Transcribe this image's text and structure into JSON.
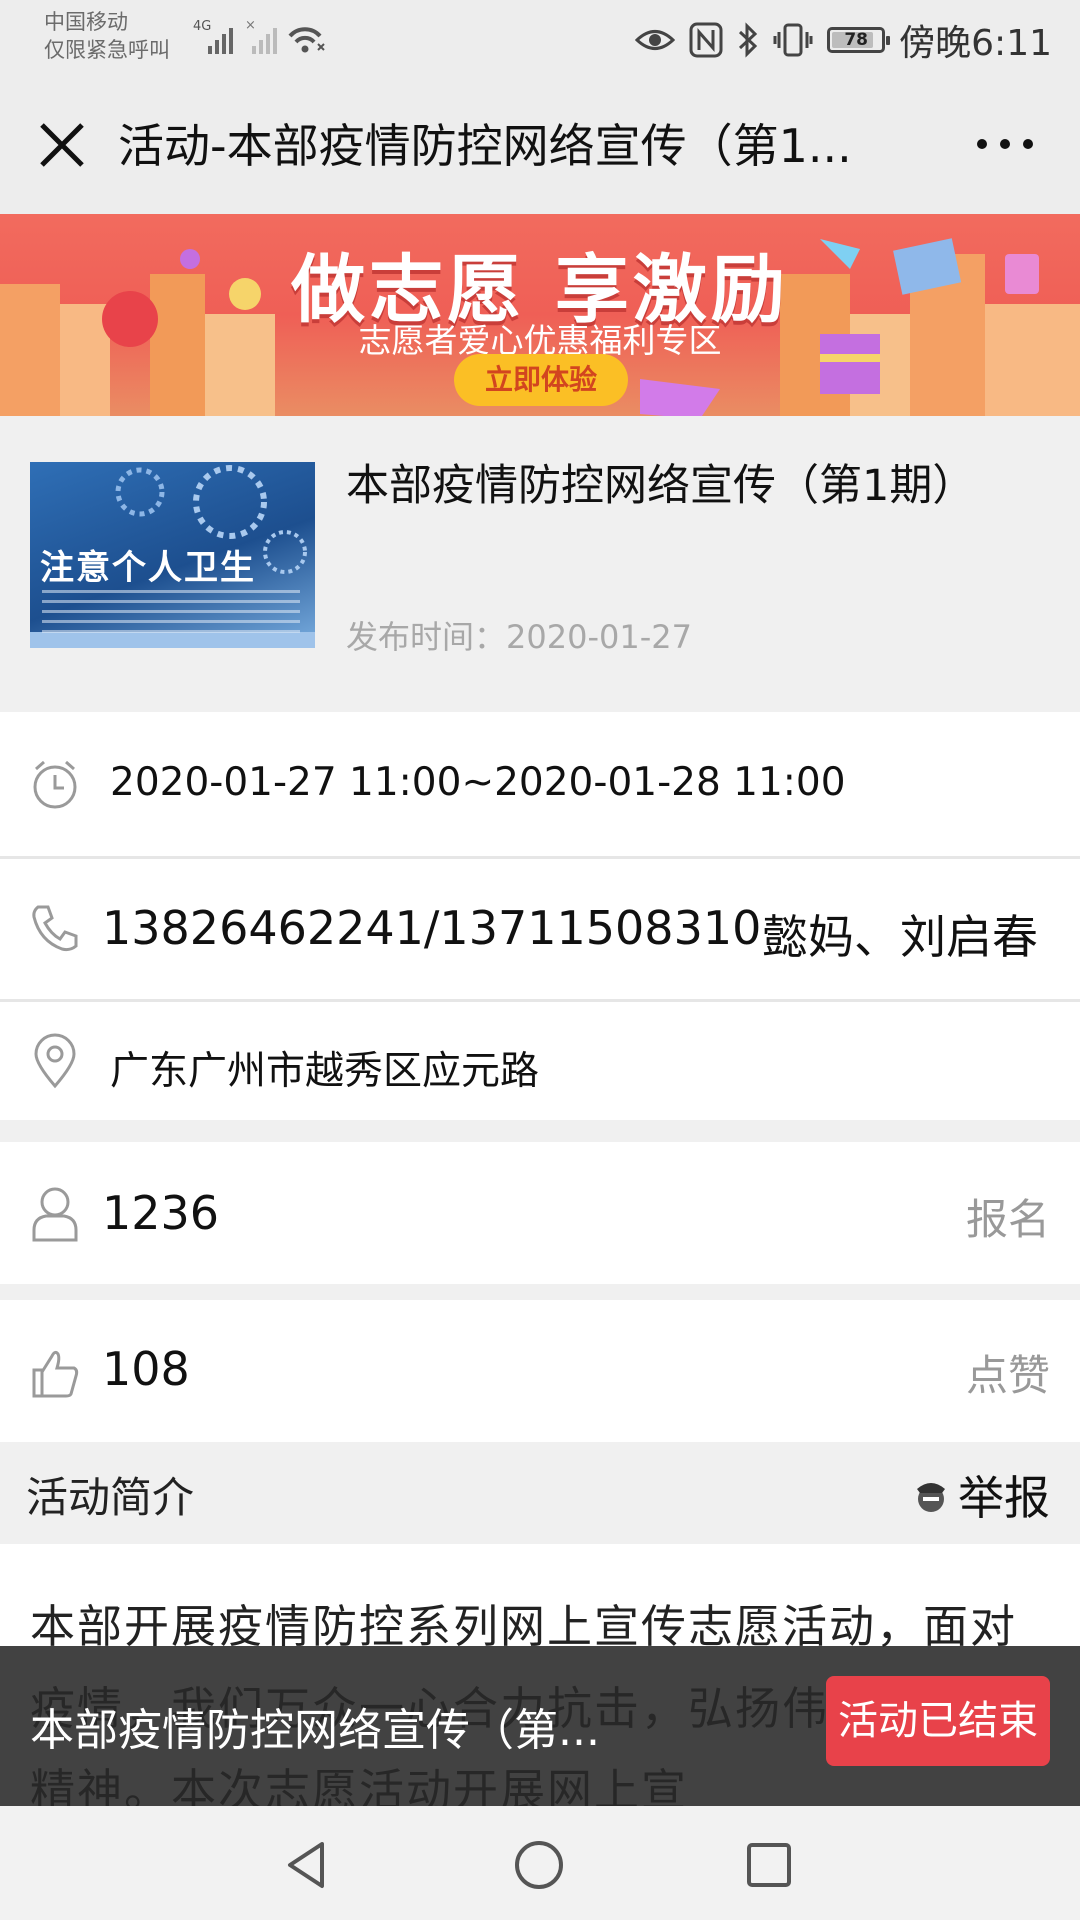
{
  "status_bar": {
    "carrier_line1": "中国移动",
    "carrier_line2": "仅限紧急呼叫",
    "network_label": "4G",
    "battery": "78",
    "time": "傍晚6:11"
  },
  "nav": {
    "title": "活动-本部疫情防控网络宣传（第1...",
    "close_icon": "close-icon",
    "more_icon": "more-dots-icon"
  },
  "banner": {
    "title": "做志愿 享激励",
    "subtitle": "志愿者爱心优惠福利专区",
    "button": "立即体验"
  },
  "activity": {
    "thumbnail_text": "注意个人卫生",
    "title": "本部疫情防控网络宣传（第1期）",
    "publish_label": "发布时间：",
    "publish_date": "2020-01-27"
  },
  "info": {
    "time_range": "2020-01-27 11:00~2020-01-28 11:00",
    "phone": "13826462241/13711508310",
    "contact": "懿妈、刘启春",
    "address": "广东广州市越秀区应元路"
  },
  "stats": {
    "signup_count": "1236",
    "signup_label": "报名",
    "like_count": "108",
    "like_label": "点赞"
  },
  "intro": {
    "section_title": "活动简介",
    "report_label": "举报",
    "text": "本部开展疫情防控系列网上宣传志愿活动，面对疫情，我们万众一心合力抗击，弘扬伟大的民族精神。本次志愿活动开展网上宣"
  },
  "footer": {
    "title": "本部疫情防控网络宣传（第...",
    "status_button": "活动已结束"
  },
  "colors": {
    "accent_red": "#e8424a",
    "banner_red": "#ef5f56",
    "banner_button": "#fbbf25"
  }
}
